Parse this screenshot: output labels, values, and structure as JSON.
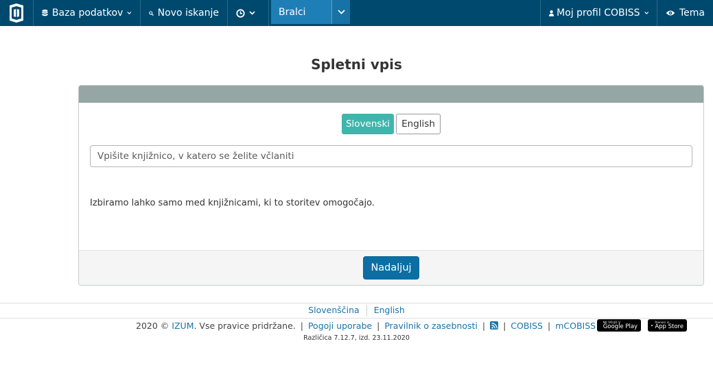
{
  "navbar": {
    "logo_icon": "cobiss-book-logo-icon",
    "database": {
      "label": "Baza podatkov",
      "icon": "database-icon"
    },
    "new_search": {
      "label": "Novo iskanje",
      "icon": "search-icon"
    },
    "history": {
      "icon": "clock-icon"
    },
    "readers": {
      "label": "Bralci"
    },
    "profile": {
      "label": "Moj profil COBISS",
      "icon": "user-icon"
    },
    "theme": {
      "label": "Tema",
      "icon": "eye-icon"
    }
  },
  "page": {
    "title": "Spletni vpis"
  },
  "form": {
    "languages": [
      {
        "label": "Slovenski",
        "active": true
      },
      {
        "label": "English",
        "active": false
      }
    ],
    "library_input": {
      "value": "",
      "placeholder": "Vpišite knjižnico, v katero se želite včlaniti"
    },
    "info_text": "Izbiramo lahko samo med knjižnicami, ki to storitev omogočajo.",
    "continue_label": "Nadaljuj"
  },
  "footer": {
    "languages": [
      "Slovenščina",
      "English"
    ],
    "copyright_prefix": "2020 ©",
    "izum": "IZUM",
    "copyright_suffix": ". Vse pravice pridržane.",
    "terms": "Pogoji uporabe",
    "privacy": "Pravilnik o zasebnosti",
    "rss_icon": "rss-icon",
    "cobiss": "COBISS",
    "mcobiss": "mCOBISS",
    "google_play_small": "NA VOLJO V",
    "google_play": "Google Play",
    "app_store_small": "Prenesi iz",
    "app_store": "App Store",
    "version": "Različica 7.12.7, izd. 23.11.2020"
  },
  "colors": {
    "navbar": "#00496e",
    "navbar_active": "#1e7fb6",
    "panel_header": "#96a6a4",
    "lang_active": "#3fb5ac",
    "primary_button": "#0b6fa4",
    "link": "#1a73a8"
  }
}
